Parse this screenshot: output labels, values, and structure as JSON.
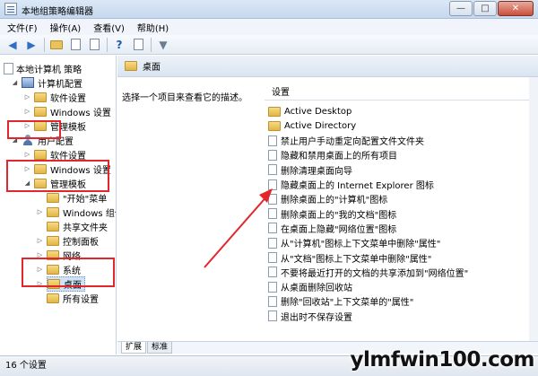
{
  "window": {
    "title": "本地组策略编辑器",
    "minimize": "—",
    "maximize": "□",
    "close": "✕"
  },
  "menu": [
    "文件(F)",
    "操作(A)",
    "查看(V)",
    "帮助(H)"
  ],
  "tree": {
    "root": "本地计算机 策略",
    "computer_config": "计算机配置",
    "cc_software": "软件设置",
    "cc_windows": "Windows 设置",
    "cc_admin": "管理模板",
    "user_config": "用户配置",
    "uc_software": "软件设置",
    "uc_windows": "Windows 设置",
    "uc_admin": "管理模板",
    "start_menu": "\"开始\"菜单",
    "windows_components": "Windows 组件",
    "shared_folders": "共享文件夹",
    "control_panel": "控制面板",
    "network": "网络",
    "system": "系统",
    "desktop": "桌面",
    "all_settings": "所有设置"
  },
  "right": {
    "header": "桌面",
    "description": "选择一个项目来查看它的描述。",
    "column_header": "设置",
    "items": [
      {
        "type": "folder",
        "label": "Active Desktop"
      },
      {
        "type": "folder",
        "label": "Active Directory"
      },
      {
        "type": "policy",
        "label": "禁止用户手动重定向配置文件文件夹"
      },
      {
        "type": "policy",
        "label": "隐藏和禁用桌面上的所有项目"
      },
      {
        "type": "policy",
        "label": "删除清理桌面向导"
      },
      {
        "type": "policy",
        "label": "隐藏桌面上的 Internet Explorer 图标"
      },
      {
        "type": "policy",
        "label": "删除桌面上的\"计算机\"图标"
      },
      {
        "type": "policy",
        "label": "删除桌面上的\"我的文档\"图标"
      },
      {
        "type": "policy",
        "label": "在桌面上隐藏\"网络位置\"图标"
      },
      {
        "type": "policy",
        "label": "从\"计算机\"图标上下文菜单中删除\"属性\""
      },
      {
        "type": "policy",
        "label": "从\"文档\"图标上下文菜单中删除\"属性\""
      },
      {
        "type": "policy",
        "label": "不要将最近打开的文档的共享添加到\"网络位置\""
      },
      {
        "type": "policy",
        "label": "从桌面删除回收站"
      },
      {
        "type": "policy",
        "label": "删除\"回收站\"上下文菜单的\"属性\""
      },
      {
        "type": "policy",
        "label": "退出时不保存设置"
      }
    ]
  },
  "tabs": {
    "extended": "扩展",
    "standard": "标准"
  },
  "status": "16 个设置",
  "watermark": "ylmfwin100.com",
  "colors": {
    "annotation": "#e2262b",
    "folder": "#e8c25a"
  }
}
